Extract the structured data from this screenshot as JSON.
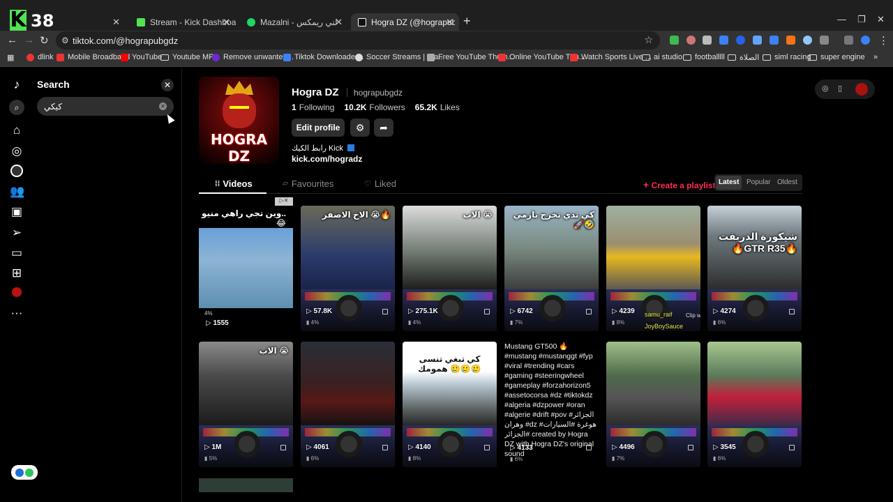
{
  "browser": {
    "logo_text": "38",
    "tabs": [
      {
        "title": "",
        "favicon_color": "#52e252"
      },
      {
        "title": "Stream - Kick Dashboard",
        "favicon_color": "#52e252"
      },
      {
        "title": "Mazalni - مزالني ريمكس • Ti",
        "favicon_color": "#1ed760"
      },
      {
        "title": "Hogra DZ (@hograpubgdz) | Ti",
        "favicon_color": "#111111"
      }
    ],
    "url": "tiktok.com/@hograpubgdz",
    "bookmarks": [
      "dlink",
      "Mobile Broadband",
      "YouTube",
      "Youtube MP4",
      "Remove unwanted...",
      "Tiktok Downloader...",
      "Soccer Streams | Wa...",
      "Free YouTube Thum...",
      "Online YouTube Thu...",
      "Watch Sports Live ...",
      "ai studio",
      "footballlll",
      "الصلاة",
      "siml racing",
      "super engine"
    ]
  },
  "search": {
    "title": "Search",
    "value": "كيكي"
  },
  "profile": {
    "avatar_text": "HOGRA DZ",
    "name": "Hogra DZ",
    "handle": "hograpubgdz",
    "following_count": "1",
    "following_label": "Following",
    "followers_count": "10.2K",
    "followers_label": "Followers",
    "likes_count": "65.2K",
    "likes_label": "Likes",
    "edit_label": "Edit profile",
    "bio_line": "رابط الكيك Kick",
    "bio_link": "kick.com/hogradz"
  },
  "tabs": {
    "videos": "Videos",
    "favourites": "Favourites",
    "liked": "Liked",
    "create_playlist": "Create a playlist",
    "sort": [
      "Latest",
      "Popular",
      "Oldest"
    ]
  },
  "videos": [
    {
      "caption": "وين تجي راهي منيو.. 😂",
      "views": "1555",
      "pct": "4%",
      "upper": "#6aa0d8",
      "kind": "ad"
    },
    {
      "caption": "الاخ الاصفر 😭🔥",
      "views": "57.8K",
      "pct": "4%",
      "upper": "#2a3a6a"
    },
    {
      "caption": "الاب 😭",
      "views": "275.1K",
      "pct": "4%",
      "upper": "#6f7a70"
    },
    {
      "caption": "كي تدي تخرج بارمي 🚀🤣",
      "views": "6742",
      "pct": "7%",
      "upper": "#7a8a80"
    },
    {
      "caption": "",
      "views": "4239",
      "pct": "8%",
      "upper": "#9a8e70",
      "chat1": "samu_raif",
      "chat1_msg": "Clip w partagi",
      "chat2": "JoyBoySauce"
    },
    {
      "caption": "شيكورة الدريفت 🔥GTR R35🔥",
      "views": "4274",
      "pct": "6%",
      "upper": "#6f7a80"
    },
    {
      "caption": "الاب 😭",
      "views": "1M",
      "pct": "5%",
      "upper": "#4a4a4a"
    },
    {
      "caption": "",
      "views": "4061",
      "pct": "6%",
      "upper": "#3a2020"
    },
    {
      "caption": "كي تبغي تنسى همومك 🥲🥲🥲",
      "views": "4140",
      "pct": "8%",
      "upper": "#b9c8d3"
    },
    {
      "caption": "Mustang GT500 🔥 #mustang #mustanggt #fyp #viral #trending #cars #gaming #steeringwheel #gameplay #forzahorizon5 #assetocorsa #dz #tiktokdz #algeria #dzpower #oran #algerie #drift #pov #الجزائر وهران #dz #هوغرة #السيارات #الجزائر created by Hogra DZ with Hogra DZ's original sound",
      "views": "4133",
      "pct": "6%",
      "kind": "text"
    },
    {
      "caption": "",
      "views": "4496",
      "pct": "7%",
      "upper": "#4f6a4a"
    },
    {
      "caption": "",
      "views": "3545",
      "pct": "6%",
      "upper": "#5a7a5a"
    }
  ],
  "colors": {
    "accent": "#fe2c55",
    "background": "#000000",
    "chrome": "#333333"
  }
}
